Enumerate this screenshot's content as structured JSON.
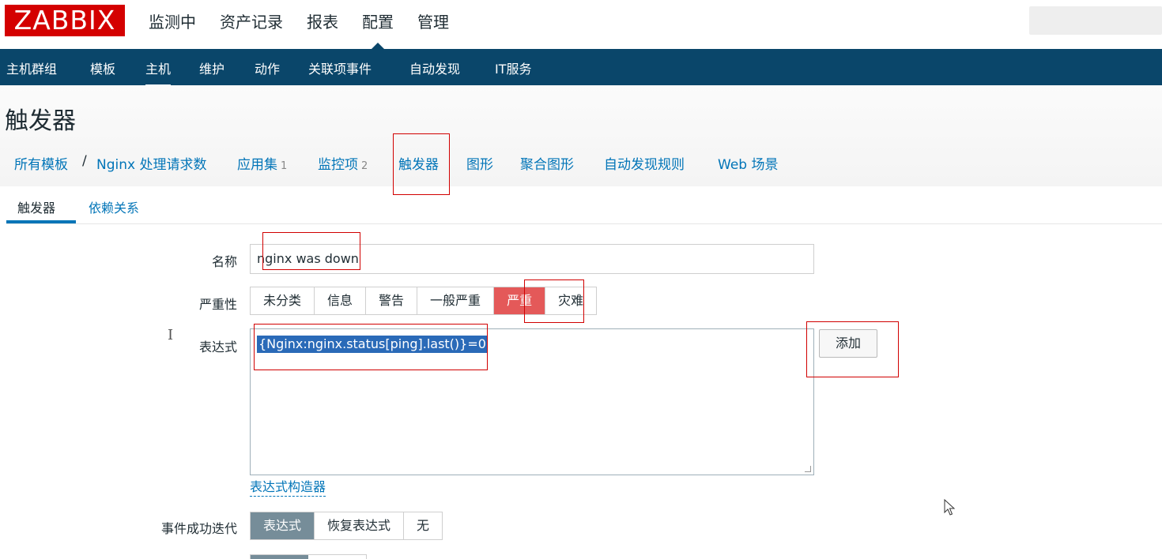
{
  "app": {
    "logo": "ZABBIX",
    "main_menu": [
      {
        "label": "监测中",
        "active": false
      },
      {
        "label": "资产记录",
        "active": false
      },
      {
        "label": "报表",
        "active": false
      },
      {
        "label": "配置",
        "active": true
      },
      {
        "label": "管理",
        "active": false
      }
    ],
    "sub_menu": [
      {
        "label": "主机群组",
        "active": false
      },
      {
        "label": "模板",
        "active": false
      },
      {
        "label": "主机",
        "active": true
      },
      {
        "label": "维护",
        "active": false
      },
      {
        "label": "动作",
        "active": false
      },
      {
        "label": "关联项事件",
        "active": false
      },
      {
        "label": "自动发现",
        "active": false
      },
      {
        "label": "IT服务",
        "active": false
      }
    ]
  },
  "page": {
    "title": "触发器",
    "breadcrumb": {
      "all_templates": "所有模板",
      "separator": "/",
      "template": "Nginx 处理请求数",
      "apps": "应用集",
      "apps_count": "1",
      "items": "监控项",
      "items_count": "2",
      "triggers": "触发器",
      "graphs": "图形",
      "screens": "聚合图形",
      "discovery": "自动发现规则",
      "web": "Web 场景"
    },
    "tabs": [
      {
        "label": "触发器",
        "active": true
      },
      {
        "label": "依赖关系",
        "active": false
      }
    ]
  },
  "form": {
    "name_label": "名称",
    "name_value": "nginx was down",
    "severity_label": "严重性",
    "severity_options": [
      "未分类",
      "信息",
      "警告",
      "一般严重",
      "严重",
      "灾难"
    ],
    "severity_selected": "严重",
    "expression_label": "表达式",
    "expression_value": "{Nginx:nginx.status[ping].last()}=0",
    "add_button": "添加",
    "expression_builder": "表达式构造器",
    "ok_event_label": "事件成功迭代",
    "ok_event_options": [
      "表达式",
      "恢复表达式",
      "无"
    ],
    "ok_event_selected": "表达式"
  },
  "colors": {
    "logo_red": "#d40000",
    "nav_blue": "#0a466a",
    "link_blue": "#0275b8",
    "severity_high": "#e45959",
    "selected_gray": "#768d99",
    "annotation_red": "#d10000"
  }
}
